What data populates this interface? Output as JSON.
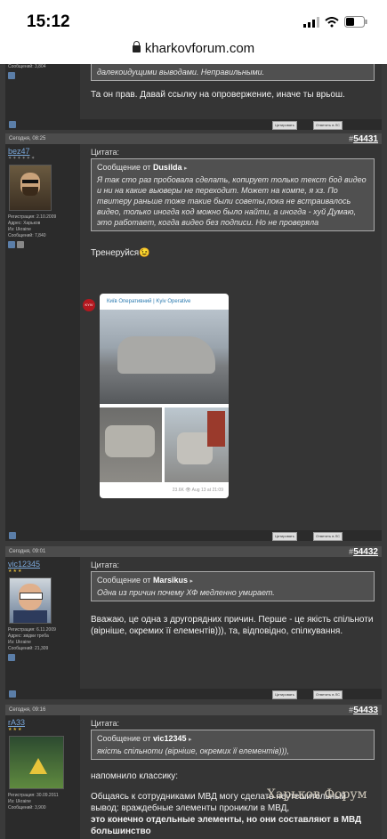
{
  "status": {
    "time": "15:12"
  },
  "browser": {
    "domain": "kharkovforum.com"
  },
  "post0": {
    "meta_count": "Сообщений: 3,804",
    "quote_tail": "далекоидущими выводами. Неправильными.",
    "body": "Та он прав. Давай ссылку на опровержение, иначе ты врьош.",
    "quote_btn": "Цитировать",
    "reply_btn": "Ответить в ЛС"
  },
  "post1": {
    "date": "Сегодня, 08:25",
    "num_prefix": "#",
    "num": "54431",
    "user": "bez47",
    "meta1": "Регистрация: 2.10.2009",
    "meta2": "Адрес: Харьков",
    "meta3": "Из: Ukraine",
    "meta4": "Сообщений: 7,840",
    "quote_label": "Цитата:",
    "quote_from_prefix": "Сообщение от",
    "quote_from": "Dusilda",
    "quote_text": "Я так сто раз пробовала сделать, копирует только текст бод видео и ни на какие вьюверы не переходит. Может на компе, я хз. По твитеру раньше тоже такие были советы,пока не встраивалось видео, только иногда код можно было найти, а иногда - хуй Думаю, это работает, когда видео без подписи. Но не проверяла",
    "body": "Тренеруйся😉",
    "card_title": "Київ Оперативний | Kyiv Operative",
    "card_logo": "KYIV",
    "card_stats": "23.6K 👁 Aug 13 at 21:09",
    "quote_btn": "Цитировать",
    "reply_btn": "Ответить в ЛС"
  },
  "post2": {
    "date": "Сегодня, 09:01",
    "num_prefix": "#",
    "num": "54432",
    "user": "vic12345",
    "meta1": "Регистрация: 6.11.2009",
    "meta2": "Адрес: звідки треба",
    "meta3": "Из: Ukraine",
    "meta4": "Сообщений: 21,309",
    "quote_label": "Цитата:",
    "quote_from_prefix": "Сообщение от",
    "quote_from": "Marsikus",
    "quote_text": "Одна из причин почему ХФ медленно умирает.",
    "body": "Вважаю, це одна з другорядних причин. Перше - це якість спільноти (вірніше, окремих її елементів))), та, відповідно, спілкування.",
    "quote_btn": "Цитировать",
    "reply_btn": "Ответить в ЛС"
  },
  "post3": {
    "date": "Сегодня, 09:16",
    "num_prefix": "#",
    "num": "54433",
    "user": "rA33",
    "meta1": "Регистрация: 30.09.2011",
    "meta3": "Из: Ukraine",
    "meta4": "Сообщений: 3,900",
    "quote_label": "Цитата:",
    "quote_from_prefix": "Сообщение от",
    "quote_from": "vic12345",
    "quote_text": "якість спільноти (вірніше, окремих її елементів))),",
    "body1": "напомнило классику:",
    "body2": "Общаясь к сотрудниками МВД могу сделать неутешительный вывод: враждебные элементы проникли в МВД,",
    "body3": "это конечно отдельные элементы, но они составляют в МВД большинство"
  },
  "watermark": "Харьков Форум"
}
